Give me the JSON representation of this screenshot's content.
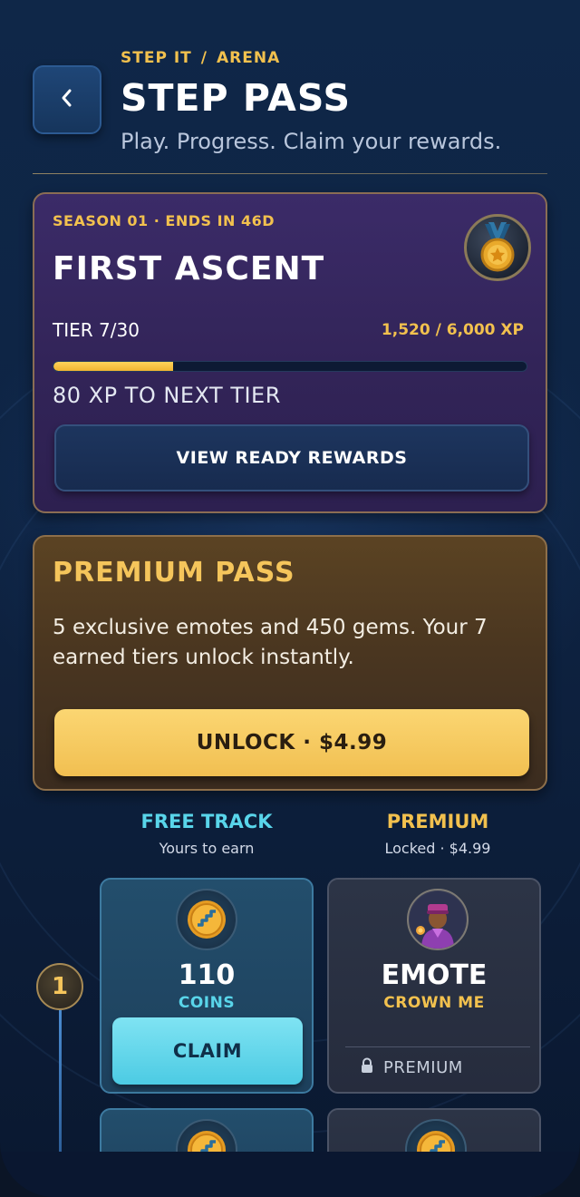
{
  "header": {
    "breadcrumb": [
      "STEP IT",
      "ARENA"
    ],
    "breadcrumb_sep": "/",
    "title": "STEP PASS",
    "subtitle": "Play. Progress. Claim your rewards."
  },
  "season": {
    "label": "SEASON 01 · ENDS IN 46D",
    "name": "FIRST ASCENT",
    "tier_text": "TIER 7/30",
    "xp_text": "1,520 / 6,000 XP",
    "progress_fraction": 0.2533,
    "next_tier_text": "80 XP TO NEXT TIER",
    "ready_button": "VIEW READY REWARDS",
    "medal_icon": "medal-icon"
  },
  "premium": {
    "title": "PREMIUM PASS",
    "description": "5 exclusive emotes and 450 gems. Your 7 earned tiers unlock instantly.",
    "unlock_button": "UNLOCK · $4.99"
  },
  "tracks": {
    "free": {
      "name": "FREE TRACK",
      "sub": "Yours to earn"
    },
    "premium": {
      "name": "PREMIUM",
      "sub": "Locked · $4.99"
    }
  },
  "tiers": [
    {
      "number": "1",
      "free": {
        "amount": "110",
        "unit": "COINS",
        "button": "CLAIM",
        "icon": "coin-icon"
      },
      "premium": {
        "type": "EMOTE",
        "name": "CROWN ME",
        "lock_label": "PREMIUM",
        "icon": "avatar-icon"
      }
    }
  ],
  "colors": {
    "accent_gold": "#f2c14e",
    "accent_cyan": "#59d5ea",
    "season_bg": "#3b2b68",
    "premium_bg": "#5b4323",
    "background": "#0e2444"
  }
}
